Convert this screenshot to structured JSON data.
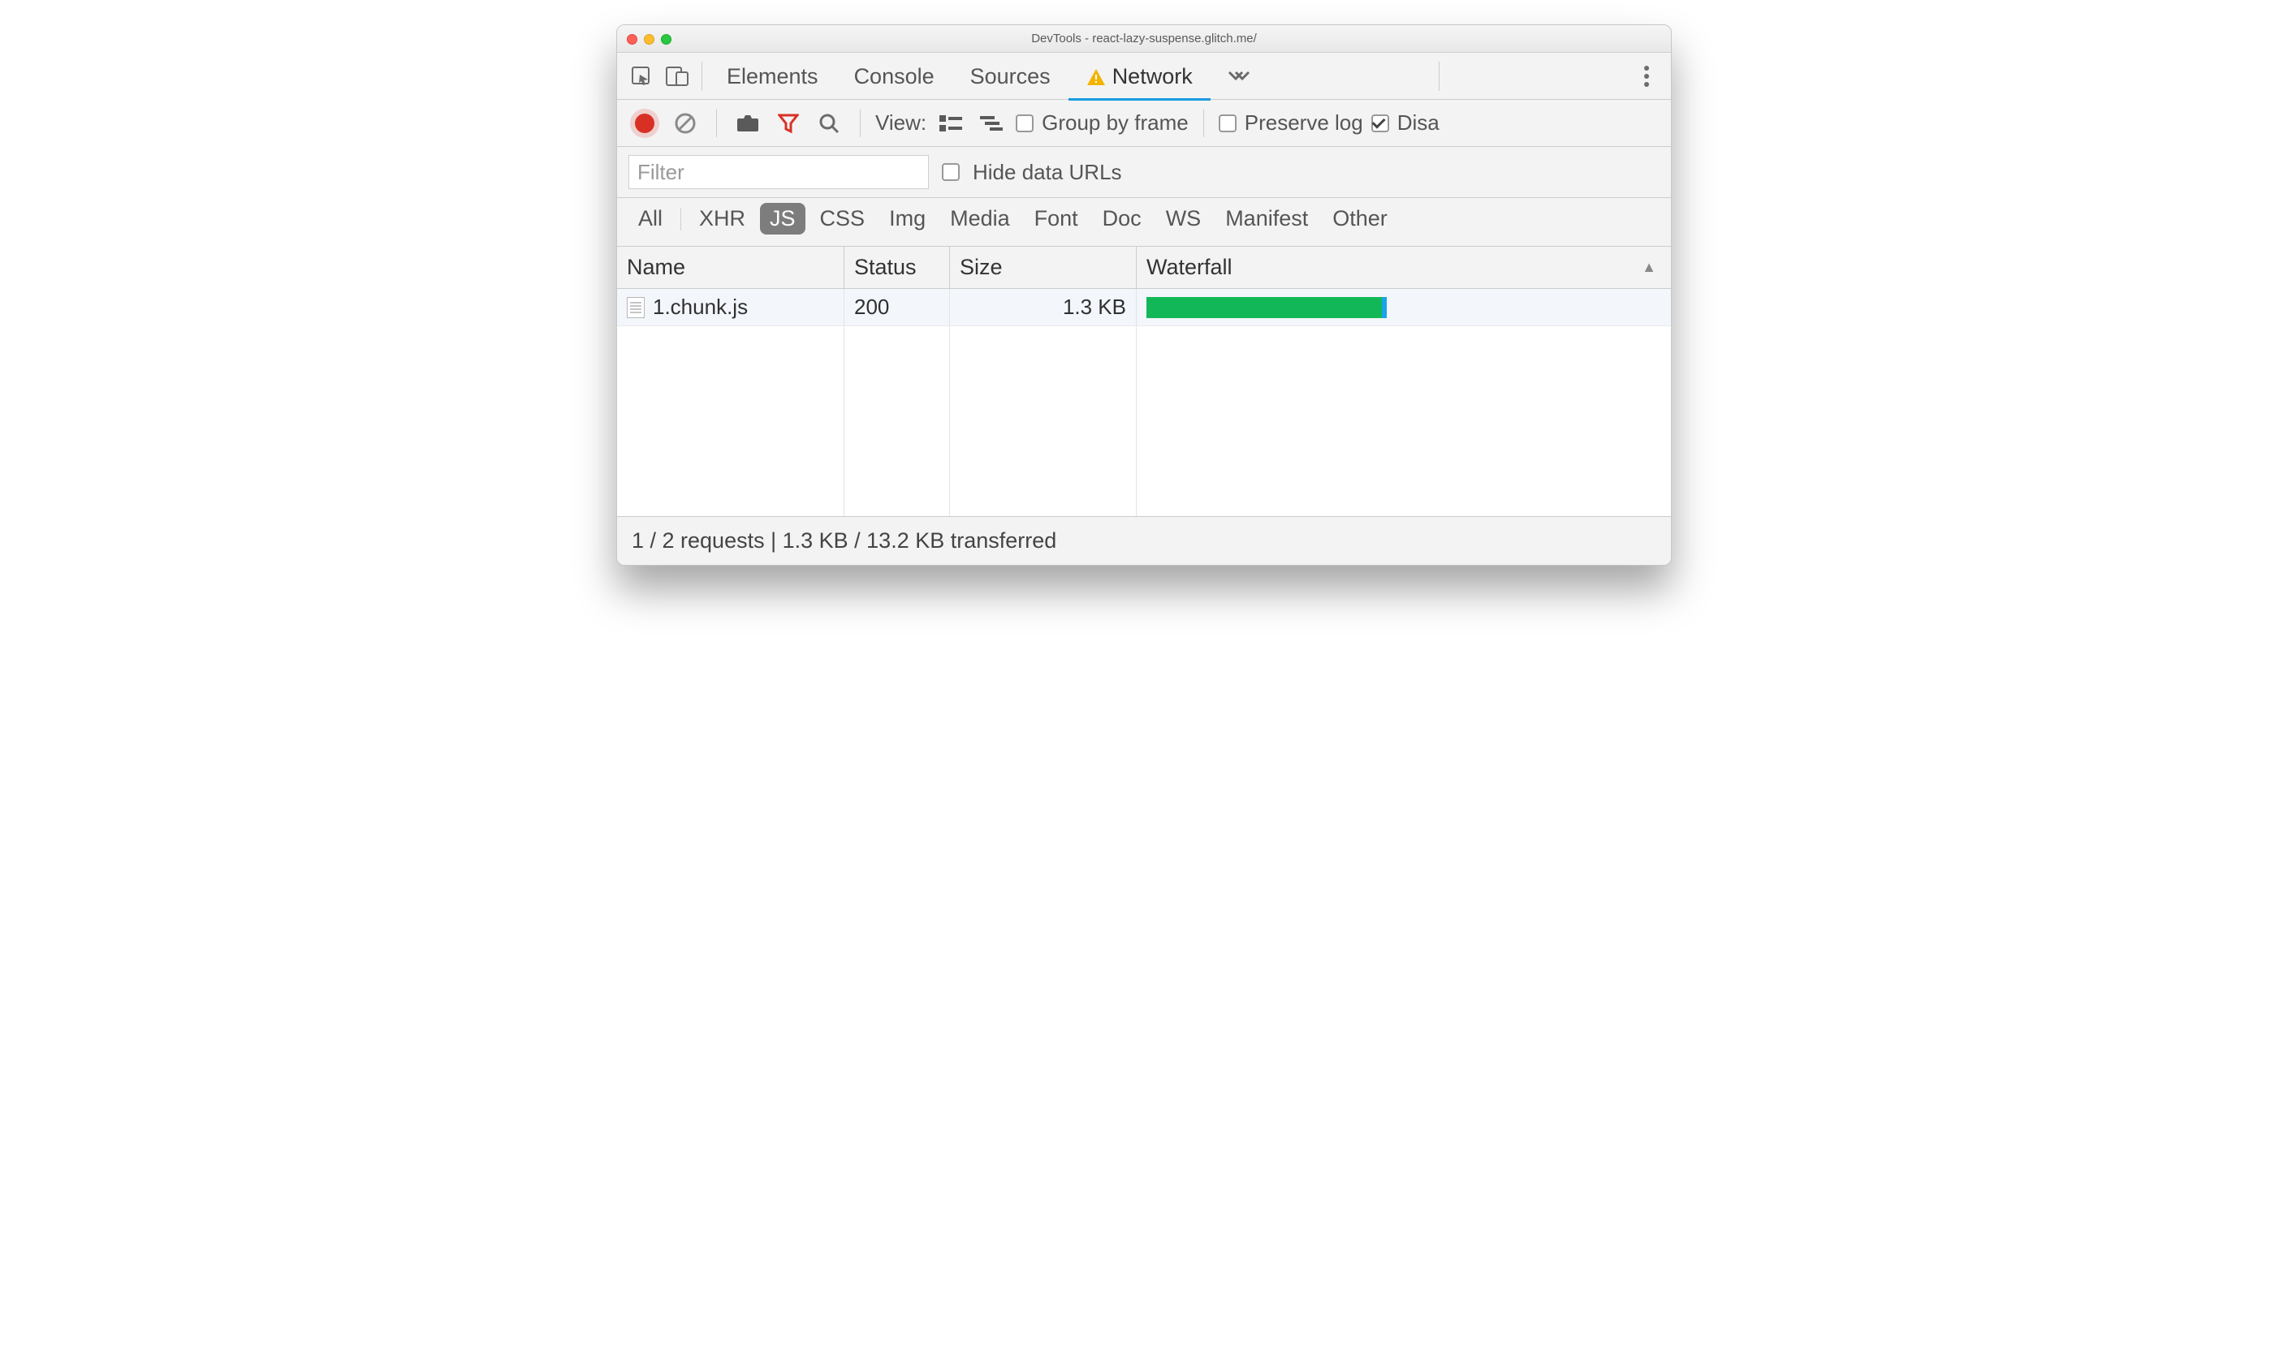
{
  "title": "DevTools - react-lazy-suspense.glitch.me/",
  "tabs": {
    "elements": "Elements",
    "console": "Console",
    "sources": "Sources",
    "network": "Network"
  },
  "toolbar": {
    "view_label": "View:",
    "group_by_frame": "Group by frame",
    "preserve_log": "Preserve log",
    "disable_cache": "Disa"
  },
  "filter": {
    "placeholder": "Filter",
    "hide_data_urls": "Hide data URLs"
  },
  "type_filters": [
    "All",
    "XHR",
    "JS",
    "CSS",
    "Img",
    "Media",
    "Font",
    "Doc",
    "WS",
    "Manifest",
    "Other"
  ],
  "active_type_filter": "JS",
  "columns": {
    "name": "Name",
    "status": "Status",
    "size": "Size",
    "waterfall": "Waterfall"
  },
  "rows": [
    {
      "name": "1.chunk.js",
      "status": "200",
      "size": "1.3 KB"
    }
  ],
  "footer": "1 / 2 requests | 1.3 KB / 13.2 KB transferred"
}
